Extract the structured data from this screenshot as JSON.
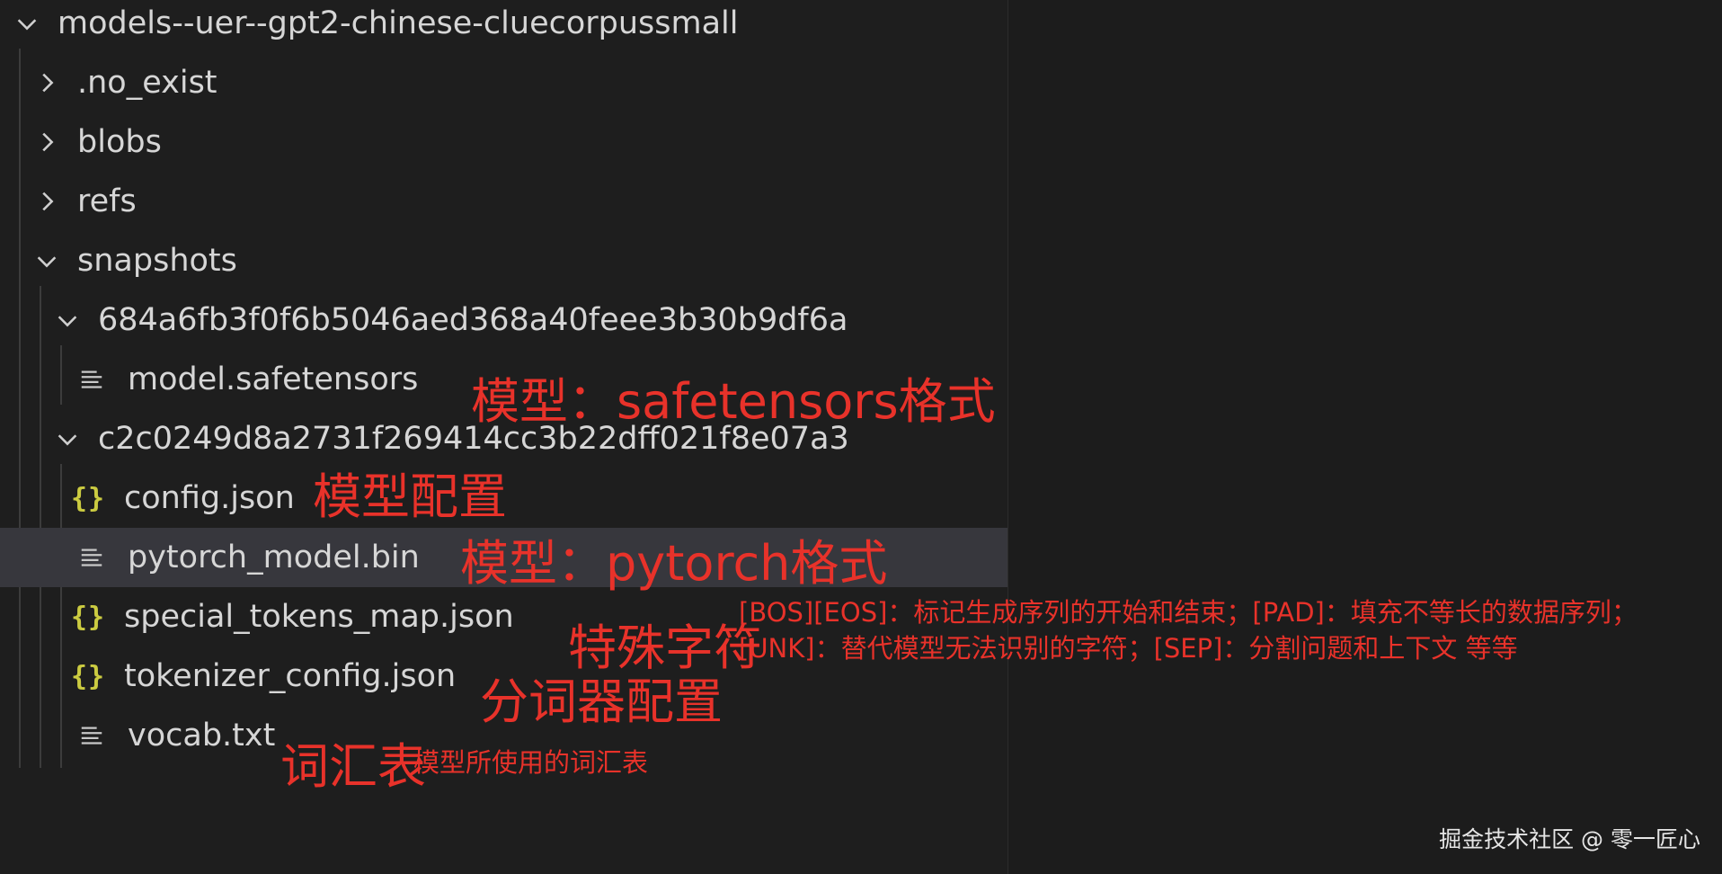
{
  "tree": {
    "root": "models--uer--gpt2-chinese-cluecorpussmall",
    "no_exist": ".no_exist",
    "blobs": "blobs",
    "refs": "refs",
    "snapshots": "snapshots",
    "snap1": "684a6fb3f0f6b5046aed368a40feee3b30b9df6a",
    "model_safetensors": "model.safetensors",
    "snap2": "c2c0249d8a2731f269414cc3b22dff021f8e07a3",
    "config_json": "config.json",
    "pytorch_model_bin": "pytorch_model.bin",
    "special_tokens_map": "special_tokens_map.json",
    "tokenizer_config": "tokenizer_config.json",
    "vocab_txt": "vocab.txt"
  },
  "annotations": {
    "safetensors": "模型：safetensors格式",
    "config": "模型配置",
    "pytorch": "模型：pytorch格式",
    "special_tokens": "特殊字符",
    "special_desc_line1": "[BOS][EOS]：标记生成序列的开始和结束；[PAD]：填充不等长的数据序列；",
    "special_desc_line2": "[UNK]：替代模型无法识别的字符；[SEP]：分割问题和上下文 等等",
    "tokenizer": "分词器配置",
    "vocab": "词汇表",
    "vocab_desc": "模型所使用的词汇表"
  },
  "watermark": "掘金技术社区 @ 零一匠心",
  "colors": {
    "annotation": "#e8322a",
    "json_icon": "#cbcb41",
    "selected_row": "#37373d"
  }
}
